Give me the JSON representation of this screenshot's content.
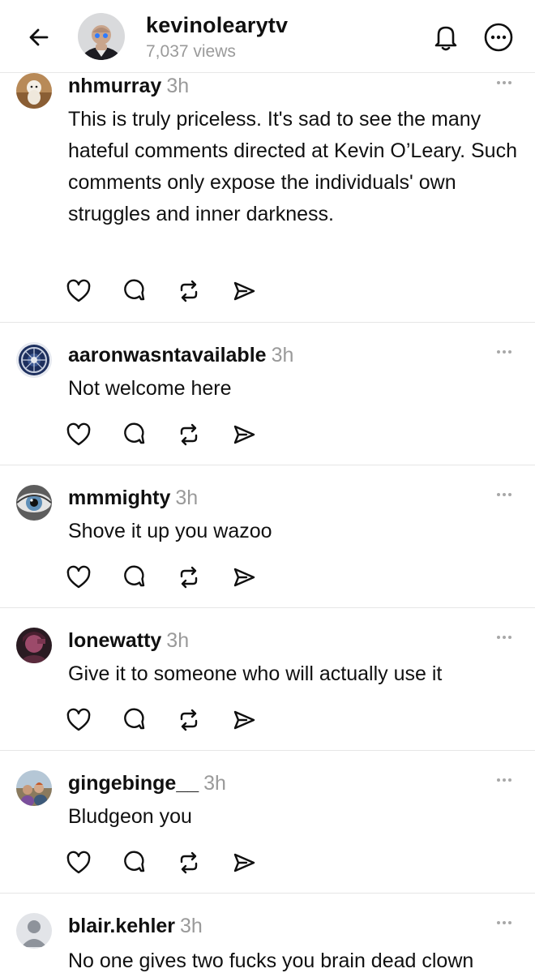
{
  "header": {
    "title": "kevinolearytv",
    "views": "7,037 views"
  },
  "comments": [
    {
      "username": "nhmurray",
      "time": "3h",
      "text": "This is truly priceless. It's sad to see the many hateful comments directed at Kevin O’Leary. Such comments only expose the individuals' own struggles and inner darkness.",
      "avatar": "dog-photo"
    },
    {
      "username": "aaronwasntavailable",
      "time": "3h",
      "text": "Not welcome here",
      "avatar": "badge-emblem"
    },
    {
      "username": "mmmighty",
      "time": "3h",
      "text": "Shove it up you wazoo",
      "avatar": "eye-photo"
    },
    {
      "username": "lonewatty",
      "time": "3h",
      "text": "Give it to someone who will actually use it",
      "avatar": "portrait-photo"
    },
    {
      "username": "gingebinge__",
      "time": "3h",
      "text": "Bludgeon you",
      "avatar": "group-photo"
    },
    {
      "username": "blair.kehler",
      "time": "3h",
      "text": "No one gives two fucks you brain dead clown",
      "avatar": "default-person"
    }
  ],
  "icons": {
    "back": "arrow-left-icon",
    "bell": "bell-icon",
    "more": "more-circle-icon",
    "like": "heart-icon",
    "reply": "comment-icon",
    "repost": "repost-icon",
    "share": "send-icon"
  },
  "colors": {
    "text": "#101010",
    "muted": "#9a9a9a",
    "divider": "#e6e6e6"
  }
}
